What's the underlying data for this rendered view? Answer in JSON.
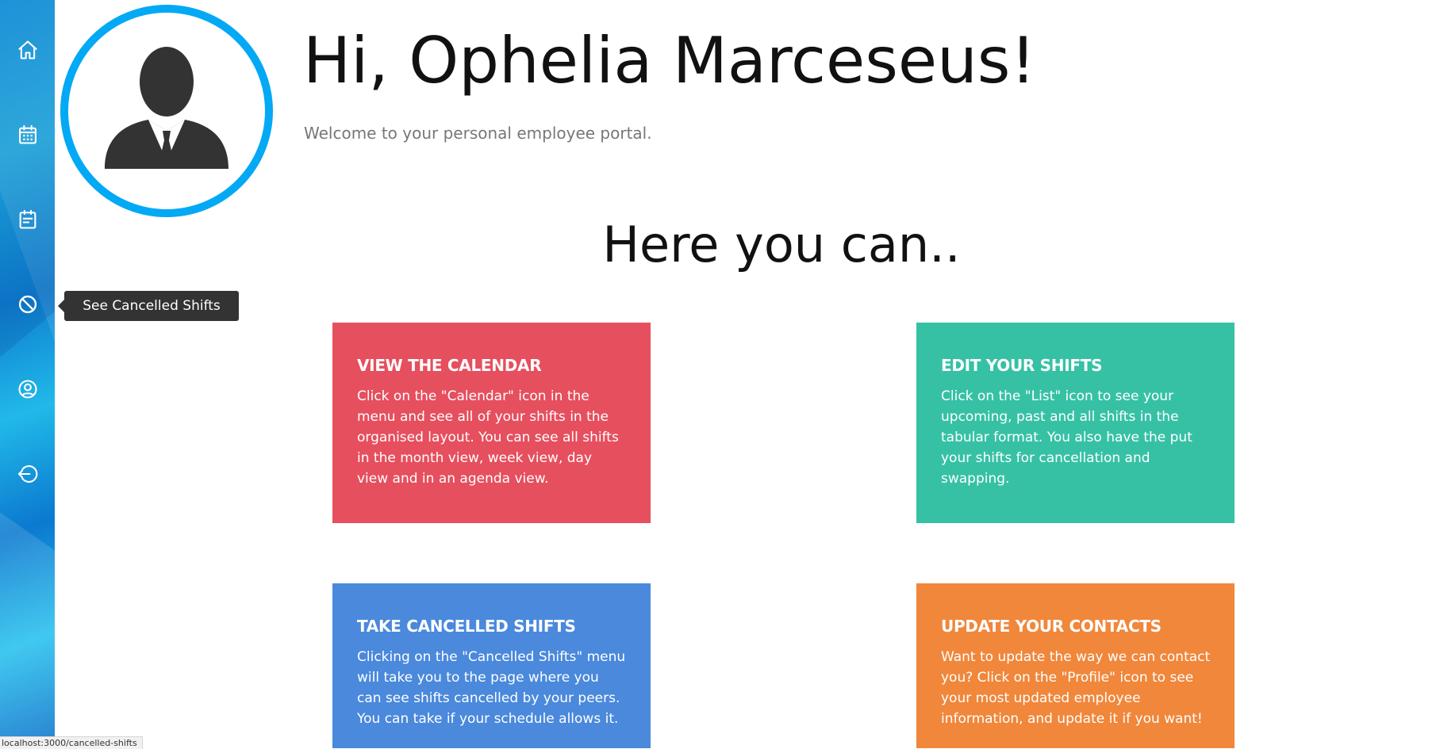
{
  "sidebar": {
    "items": [
      {
        "icon": "home-icon"
      },
      {
        "icon": "calendar-icon"
      },
      {
        "icon": "list-icon"
      },
      {
        "icon": "cancel-icon"
      },
      {
        "icon": "profile-icon"
      },
      {
        "icon": "logout-icon"
      }
    ],
    "tooltip": "See Cancelled Shifts"
  },
  "header": {
    "greeting": "Hi, Ophelia Marceseus!",
    "welcome": "Welcome to your personal employee portal."
  },
  "section": {
    "title": "Here you can.."
  },
  "cards": [
    {
      "title": "VIEW THE CALENDAR",
      "text": "Click on the \"Calendar\" icon in the menu and see all of your shifts in the organised layout. You can see all shifts in the month view, week view, day view and in an agenda view.",
      "color": "#e64f5e"
    },
    {
      "title": "EDIT YOUR SHIFTS",
      "text": "Click on the \"List\" icon to see your upcoming, past and all shifts in the tabular format. You also have the put your shifts for cancellation and swapping.",
      "color": "#36c1a5"
    },
    {
      "title": "TAKE CANCELLED SHIFTS",
      "text": "Clicking on the \"Cancelled Shifts\" menu will take you to the page where you can see shifts cancelled by your peers. You can take if your schedule allows it.",
      "color": "#4a89dc"
    },
    {
      "title": "UPDATE YOUR CONTACTS",
      "text": "Want to update the way we can contact you? Click on the \"Profile\" icon to see your most updated employee information, and update it if you want!",
      "color": "#f0873b"
    }
  ],
  "status_bar": {
    "url": "localhost:3000/cancelled-shifts"
  },
  "colors": {
    "avatar_ring": "#03a9f4",
    "avatar_figure": "#333333",
    "tooltip_bg": "#333333"
  }
}
